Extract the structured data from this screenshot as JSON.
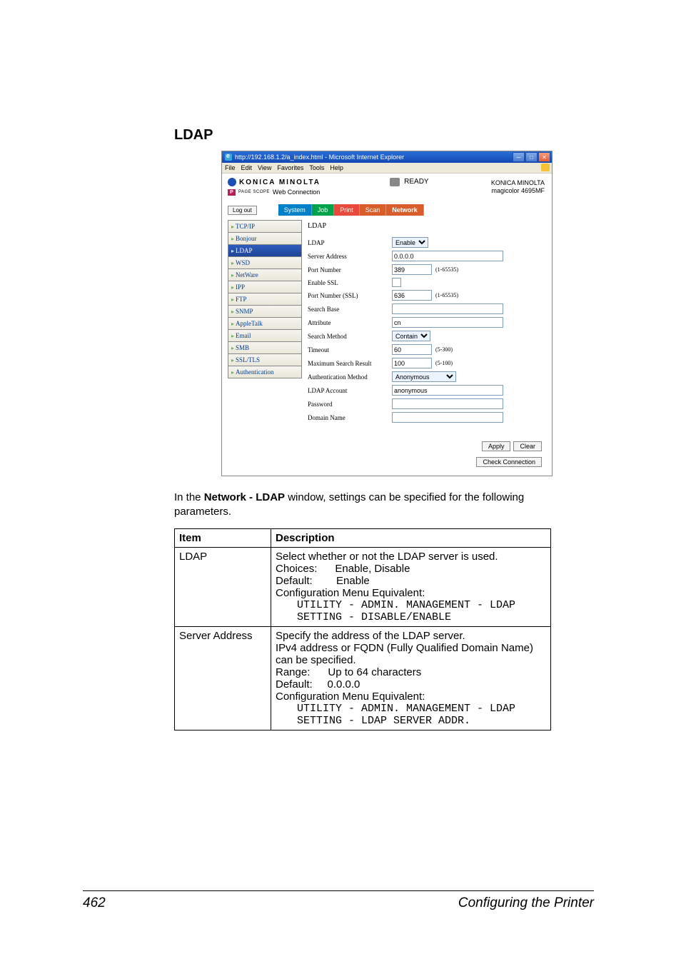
{
  "section_title": "LDAP",
  "window": {
    "title": "http://192.168.1.2/a_index.html - Microsoft Internet Explorer",
    "menu": [
      "File",
      "Edit",
      "View",
      "Favorites",
      "Tools",
      "Help"
    ]
  },
  "header": {
    "brand_line1": "KONICA MINOLTA",
    "pagescope": "PAGE SCOPE",
    "web_connection": "Web Connection",
    "status": "READY",
    "device_line1": "KONICA MINOLTA",
    "device_line2": "magicolor 4695MF"
  },
  "logout_label": "Log out",
  "tabs": {
    "system": "System",
    "job": "Job",
    "print": "Print",
    "scan": "Scan",
    "network": "Network"
  },
  "sidebar": {
    "items": [
      "TCP/IP",
      "Bonjour",
      "LDAP",
      "WSD",
      "NetWare",
      "IPP",
      "FTP",
      "SNMP",
      "AppleTalk",
      "Email",
      "SMB",
      "SSL/TLS",
      "Authentication"
    ],
    "active_index": 2
  },
  "pane": {
    "title": "LDAP",
    "ldap_label": "LDAP",
    "ldap_value": "Enable",
    "server_address_label": "Server Address",
    "server_address_value": "0.0.0.0",
    "port_label": "Port Number",
    "port_value": "389",
    "port_hint": "(1-65535)",
    "enable_ssl_label": "Enable SSL",
    "port_ssl_label": "Port Number (SSL)",
    "port_ssl_value": "636",
    "port_ssl_hint": "(1-65535)",
    "search_base_label": "Search Base",
    "search_base_value": "",
    "attribute_label": "Attribute",
    "attribute_value": "cn",
    "search_method_label": "Search Method",
    "search_method_value": "Contain",
    "timeout_label": "Timeout",
    "timeout_value": "60",
    "timeout_hint": "(5-300)",
    "max_results_label": "Maximum Search Result",
    "max_results_value": "100",
    "max_results_hint": "(5-100)",
    "auth_method_label": "Authentication Method",
    "auth_method_value": "Anonymous",
    "ldap_account_label": "LDAP Account",
    "ldap_account_value": "anonymous",
    "password_label": "Password",
    "password_value": "",
    "domain_label": "Domain Name",
    "domain_value": ""
  },
  "buttons": {
    "apply": "Apply",
    "clear": "Clear",
    "check": "Check Connection"
  },
  "body_text_pre": "In the ",
  "body_text_bold": "Network - LDAP",
  "body_text_post": " window, settings can be specified for the following parameters.",
  "table": {
    "h1": "Item",
    "h2": "Description",
    "row1": {
      "item": "LDAP",
      "l1": "Select whether or not the LDAP server is used.",
      "l2": "Choices:      Enable, Disable",
      "l3": "Default:        Enable",
      "l4": "Configuration Menu Equivalent:",
      "m1": "UTILITY - ADMIN. MANAGEMENT - LDAP",
      "m2": "SETTING - DISABLE/ENABLE"
    },
    "row2": {
      "item": "Server Address",
      "l1": "Specify the address of the LDAP server.",
      "l2": "IPv4 address or FQDN (Fully Qualified Domain Name) can be specified.",
      "l3": "Range:      Up to 64 characters",
      "l4": "Default:     0.0.0.0",
      "l5": "Configuration Menu Equivalent:",
      "m1": "UTILITY - ADMIN. MANAGEMENT - LDAP",
      "m2": "SETTING - LDAP SERVER ADDR."
    }
  },
  "footer": {
    "page": "462",
    "chapter": "Configuring the Printer"
  }
}
